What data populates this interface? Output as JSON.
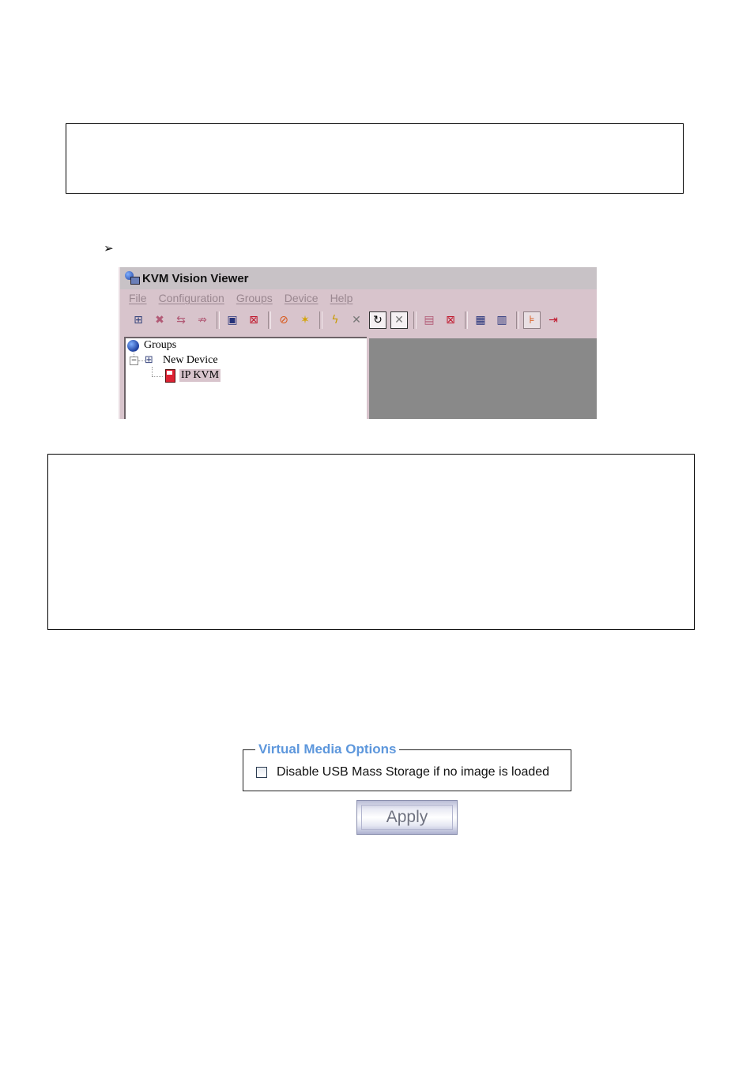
{
  "bullet": "➢",
  "kvm_window": {
    "title": "KVM Vision Viewer",
    "menu": [
      "File",
      "Configuration",
      "Groups",
      "Device",
      "Help"
    ],
    "toolbar_icons": [
      "add-device-icon",
      "delete-device-icon",
      "connect-device-icon",
      "disconnect-device-icon",
      "open-console-icon",
      "close-console-icon",
      "properties-icon",
      "wizard-icon",
      "power-icon",
      "power-off-icon",
      "reset-icon",
      "stop-icon",
      "macro-icon",
      "cancel-icon",
      "settings-icon",
      "display-icon",
      "tree-view-icon",
      "exit-icon"
    ],
    "tree": {
      "root": "Groups",
      "group": "New Device",
      "device": "IP KVM"
    }
  },
  "virtual_media": {
    "legend": "Virtual Media Options",
    "checkbox_label": "Disable USB Mass Storage if no image is loaded",
    "checked": false,
    "apply_label": "Apply"
  }
}
